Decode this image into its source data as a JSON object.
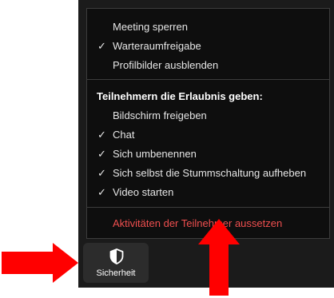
{
  "menu": {
    "items_top": [
      {
        "label": "Meeting sperren",
        "checked": false
      },
      {
        "label": "Warteraumfreigabe",
        "checked": true
      },
      {
        "label": "Profilbilder ausblenden",
        "checked": false
      }
    ],
    "section_title": "Teilnehmern die Erlaubnis geben:",
    "permissions": [
      {
        "label": "Bildschirm freigeben",
        "checked": false
      },
      {
        "label": "Chat",
        "checked": true
      },
      {
        "label": "Sich umbenennen",
        "checked": true
      },
      {
        "label": "Sich selbst die Stummschaltung aufheben",
        "checked": true
      },
      {
        "label": "Video starten",
        "checked": true
      }
    ],
    "suspend_label": "Aktivitäten der Teilnehmer aussetzen",
    "check_glyph": "✓"
  },
  "toolbar": {
    "security_label": "Sicherheit",
    "security_icon": "shield-icon"
  },
  "colors": {
    "menu_bg": "#0e0e0e",
    "window_bg": "#1b1b1b",
    "text": "#e6e6e6",
    "danger": "#ef4f4f",
    "annotation_arrow": "#ff0000"
  }
}
